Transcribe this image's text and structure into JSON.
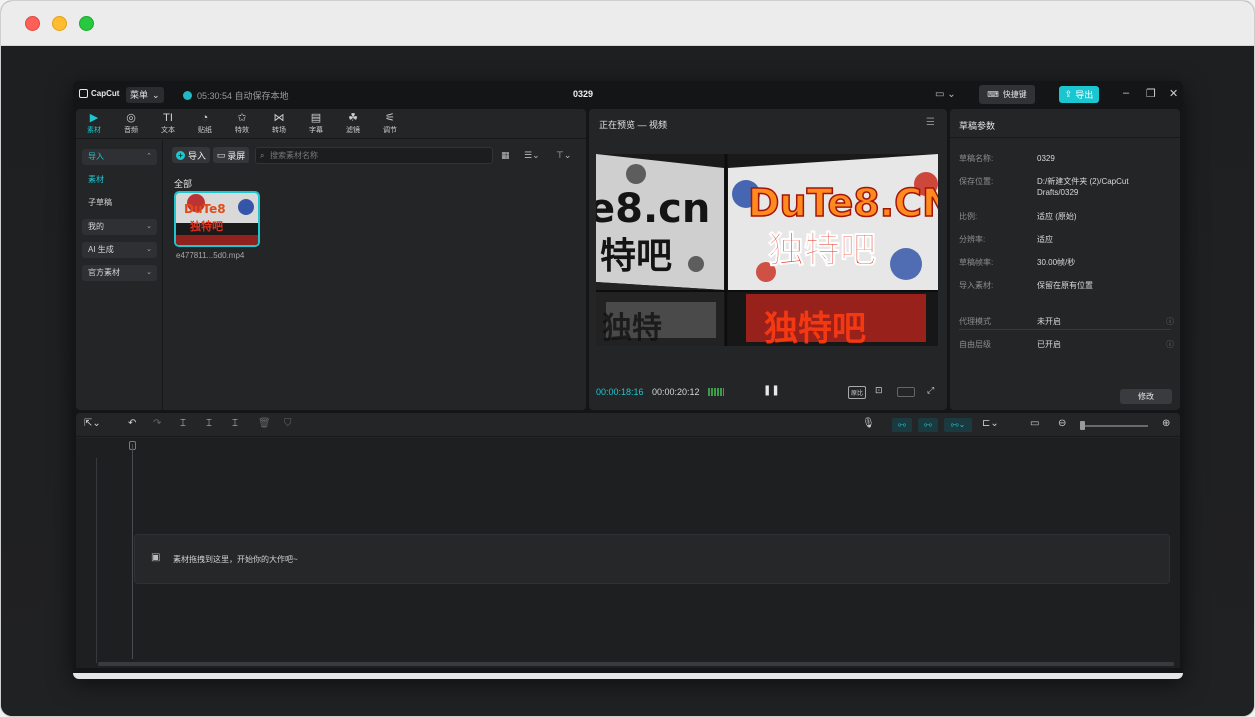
{
  "app": {
    "logo": "CapCut",
    "menu_label": "菜单",
    "autosave_status": "05:30:54 自动保存本地",
    "project_name": "0329",
    "shortcut_label": "快捷键",
    "export_label": "导出"
  },
  "tool_tabs": [
    {
      "label": "素材",
      "icon": "media-icon"
    },
    {
      "label": "音频",
      "icon": "audio-icon"
    },
    {
      "label": "文本",
      "icon": "text-icon"
    },
    {
      "label": "贴纸",
      "icon": "sticker-icon"
    },
    {
      "label": "特效",
      "icon": "effects-icon"
    },
    {
      "label": "转场",
      "icon": "transition-icon"
    },
    {
      "label": "字幕",
      "icon": "subtitle-icon"
    },
    {
      "label": "滤镜",
      "icon": "filter-icon"
    },
    {
      "label": "调节",
      "icon": "adjust-icon"
    }
  ],
  "media_sidebar": {
    "items": [
      {
        "label": "导入"
      },
      {
        "label": "素材"
      },
      {
        "label": "子草稿"
      },
      {
        "label": "我的"
      },
      {
        "label": "AI 生成"
      },
      {
        "label": "官方素材"
      }
    ]
  },
  "media": {
    "import_label": "导入",
    "record_label": "录屏",
    "search_placeholder": "搜索素材名称",
    "all_label": "全部",
    "clip_name": "e477811...5d0.mp4",
    "thumb_text_1": "DuTe8",
    "thumb_text_2": "独特吧"
  },
  "preview": {
    "header": "正在预览 — 视频",
    "current_time": "00:00:18:16",
    "total_time": "00:00:20:12",
    "ratio_label": "原比",
    "video_text_left": "e8.cn",
    "video_text_left_2": "特吧",
    "video_text_right": "DuTe8.CN",
    "video_text_right_2": "独特吧",
    "video_text_bottom_left": "独特",
    "video_text_bottom_right": "独特吧"
  },
  "draft_props": {
    "header": "草稿参数",
    "rows": [
      {
        "key": "草稿名称:",
        "value": "0329"
      },
      {
        "key": "保存位置:",
        "value": "D:/新建文件夹 (2)/CapCut Drafts/0329"
      },
      {
        "key": "比例:",
        "value": "适应 (原始)"
      },
      {
        "key": "分辨率:",
        "value": "适应"
      },
      {
        "key": "草稿帧率:",
        "value": "30.00帧/秒"
      },
      {
        "key": "导入素材:",
        "value": "保留在原有位置"
      },
      {
        "key": "代理模式",
        "value": "未开启"
      },
      {
        "key": "自由层级",
        "value": "已开启"
      }
    ],
    "modify_label": "修改"
  },
  "timeline": {
    "drop_hint": "素材拖拽到这里，开始你的大作吧~"
  },
  "colors": {
    "accent": "#1ec6cf",
    "background": "#141517",
    "panel": "#242527"
  }
}
